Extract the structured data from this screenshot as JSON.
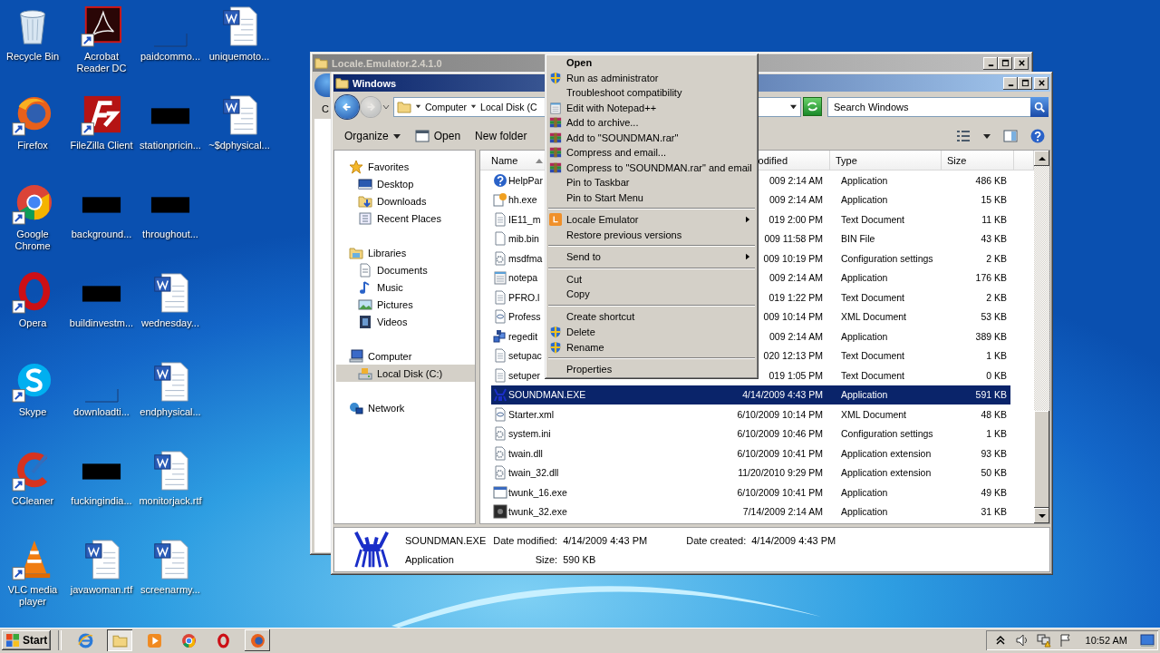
{
  "desktop": {
    "icons": [
      {
        "label": "Recycle Bin",
        "kind": "recycle",
        "shortcut": false
      },
      {
        "label": "Firefox",
        "kind": "firefox",
        "shortcut": true
      },
      {
        "label": "Google Chrome",
        "kind": "chrome",
        "shortcut": true
      },
      {
        "label": "Opera",
        "kind": "opera",
        "shortcut": true
      },
      {
        "label": "Skype",
        "kind": "skype",
        "shortcut": true
      },
      {
        "label": "CCleaner",
        "kind": "ccleaner",
        "shortcut": true
      },
      {
        "label": "VLC media player",
        "kind": "vlc",
        "shortcut": true
      },
      {
        "label": "Acrobat Reader DC",
        "kind": "pdf",
        "shortcut": true
      },
      {
        "label": "FileZilla Client",
        "kind": "filezilla",
        "shortcut": true
      },
      {
        "label": "background...",
        "kind": "redacted",
        "shortcut": false
      },
      {
        "label": "buildinvestm...",
        "kind": "redacted",
        "shortcut": false
      },
      {
        "label": "downloadti...",
        "kind": "blank",
        "shortcut": false
      },
      {
        "label": "fuckingindia...",
        "kind": "redacted",
        "shortcut": false
      },
      {
        "label": "javawoman.rtf",
        "kind": "word",
        "shortcut": false
      },
      {
        "label": "paidcommo...",
        "kind": "blank",
        "shortcut": false
      },
      {
        "label": "stationpricin...",
        "kind": "redacted",
        "shortcut": false
      },
      {
        "label": "throughout...",
        "kind": "redacted",
        "shortcut": false
      },
      {
        "label": "wednesday...",
        "kind": "word",
        "shortcut": false
      },
      {
        "label": "endphysical...",
        "kind": "word",
        "shortcut": false
      },
      {
        "label": "monitorjack.rtf",
        "kind": "word",
        "shortcut": false
      },
      {
        "label": "screenarmy...",
        "kind": "word",
        "shortcut": false
      },
      {
        "label": "uniquemoto...",
        "kind": "word",
        "shortcut": false
      },
      {
        "label": "~$dphysical...",
        "kind": "word",
        "shortcut": false
      }
    ]
  },
  "back_window": {
    "title": "Locale.Emulator.2.4.1.0",
    "toolbar_text": "C"
  },
  "explorer": {
    "title": "Windows",
    "nav_buttons": [
      {
        "kind": "back",
        "disabled": false
      },
      {
        "kind": "forward",
        "disabled": true
      }
    ],
    "breadcrumbs": [
      "Computer",
      "Local Disk (C"
    ],
    "search": {
      "placeholder": "Search Windows"
    },
    "toolbar": [
      {
        "label": "Organize",
        "kind": "menu"
      },
      {
        "label": "Open",
        "kind": "icon"
      },
      {
        "label": "New folder",
        "kind": "plain"
      }
    ],
    "nav": [
      {
        "label": "Favorites",
        "kind": "star",
        "selected": false,
        "children": [
          {
            "label": "Desktop",
            "kind": "desktop",
            "selected": false
          },
          {
            "label": "Downloads",
            "kind": "downloads",
            "selected": false
          },
          {
            "label": "Recent Places",
            "kind": "recent",
            "selected": false
          }
        ]
      },
      {
        "label": "Libraries",
        "kind": "libraries",
        "selected": false,
        "children": [
          {
            "label": "Documents",
            "kind": "documents",
            "selected": false
          },
          {
            "label": "Music",
            "kind": "music",
            "selected": false
          },
          {
            "label": "Pictures",
            "kind": "pictures",
            "selected": false
          },
          {
            "label": "Videos",
            "kind": "videos",
            "selected": false
          }
        ]
      },
      {
        "label": "Computer",
        "kind": "computer",
        "selected": false,
        "children": [
          {
            "label": "Local Disk (C:)",
            "kind": "disk",
            "selected": true
          }
        ]
      },
      {
        "label": "Network",
        "kind": "network",
        "selected": false
      }
    ],
    "columns": [
      {
        "label": "Name",
        "sorted": true
      },
      {
        "label": "odified",
        "sorted": false
      },
      {
        "label": "Type",
        "sorted": false
      },
      {
        "label": "Size",
        "sorted": false
      }
    ],
    "files": [
      {
        "name": "HelpPar",
        "kind": "help",
        "date": "009 2:14 AM",
        "type": "Application",
        "size": "486 KB",
        "selected": false
      },
      {
        "name": "hh.exe",
        "kind": "helpdoc",
        "date": "009 2:14 AM",
        "type": "Application",
        "size": "15 KB",
        "selected": false
      },
      {
        "name": "IE11_m",
        "kind": "text",
        "date": "019 2:00 PM",
        "type": "Text Document",
        "size": "11 KB",
        "selected": false
      },
      {
        "name": "mib.bin",
        "kind": "blank",
        "date": "009 11:58 PM",
        "type": "BIN File",
        "size": "43 KB",
        "selected": false
      },
      {
        "name": "msdfma",
        "kind": "config",
        "date": "009 10:19 PM",
        "type": "Configuration settings",
        "size": "2 KB",
        "selected": false
      },
      {
        "name": "notepa",
        "kind": "notepad",
        "date": "009 2:14 AM",
        "type": "Application",
        "size": "176 KB",
        "selected": false
      },
      {
        "name": "PFRO.l",
        "kind": "text",
        "date": "019 1:22 PM",
        "type": "Text Document",
        "size": "2 KB",
        "selected": false
      },
      {
        "name": "Profess",
        "kind": "xml",
        "date": "009 10:14 PM",
        "type": "XML Document",
        "size": "53 KB",
        "selected": false
      },
      {
        "name": "regedit",
        "kind": "regedit",
        "date": "009 2:14 AM",
        "type": "Application",
        "size": "389 KB",
        "selected": false
      },
      {
        "name": "setupac",
        "kind": "text",
        "date": "020 12:13 PM",
        "type": "Text Document",
        "size": "1 KB",
        "selected": false
      },
      {
        "name": "setuper",
        "kind": "text",
        "date": "019 1:05 PM",
        "type": "Text Document",
        "size": "0 KB",
        "selected": false
      },
      {
        "name": "SOUNDMAN.EXE",
        "kind": "crab",
        "date": "4/14/2009 4:43 PM",
        "type": "Application",
        "size": "591 KB",
        "selected": true
      },
      {
        "name": "Starter.xml",
        "kind": "xml",
        "date": "6/10/2009 10:14 PM",
        "type": "XML Document",
        "size": "48 KB",
        "selected": false
      },
      {
        "name": "system.ini",
        "kind": "config",
        "date": "6/10/2009 10:46 PM",
        "type": "Configuration settings",
        "size": "1 KB",
        "selected": false
      },
      {
        "name": "twain.dll",
        "kind": "dll",
        "date": "6/10/2009 10:41 PM",
        "type": "Application extension",
        "size": "93 KB",
        "selected": false
      },
      {
        "name": "twain_32.dll",
        "kind": "dll",
        "date": "11/20/2010 9:29 PM",
        "type": "Application extension",
        "size": "50 KB",
        "selected": false
      },
      {
        "name": "twunk_16.exe",
        "kind": "window",
        "date": "6/10/2009 10:41 PM",
        "type": "Application",
        "size": "49 KB",
        "selected": false
      },
      {
        "name": "twunk_32.exe",
        "kind": "dark",
        "date": "7/14/2009 2:14 AM",
        "type": "Application",
        "size": "31 KB",
        "selected": false
      }
    ],
    "details": {
      "name": "SOUNDMAN.EXE",
      "type": "Application",
      "fields": [
        {
          "label": "Date modified:",
          "value": "4/14/2009 4:43 PM"
        },
        {
          "label": "Date created:",
          "value": "4/14/2009 4:43 PM"
        },
        {
          "label": "Size:",
          "value": "590 KB"
        }
      ]
    }
  },
  "context_menu": {
    "items": [
      {
        "kind": "plain",
        "label": "Open",
        "default": true,
        "submenu": false
      },
      {
        "kind": "shield",
        "label": "Run as administrator",
        "default": false,
        "submenu": false
      },
      {
        "kind": "plain",
        "label": "Troubleshoot compatibility",
        "default": false,
        "submenu": false
      },
      {
        "kind": "notepad",
        "label": "Edit with Notepad++",
        "default": false,
        "submenu": false
      },
      {
        "kind": "rar",
        "label": "Add to archive...",
        "default": false,
        "submenu": false
      },
      {
        "kind": "rar",
        "label": "Add to \"SOUNDMAN.rar\"",
        "default": false,
        "submenu": false
      },
      {
        "kind": "rar",
        "label": "Compress and email...",
        "default": false,
        "submenu": false
      },
      {
        "kind": "rar",
        "label": "Compress to \"SOUNDMAN.rar\" and email",
        "default": false,
        "submenu": false
      },
      {
        "kind": "plain",
        "label": "Pin to Taskbar",
        "default": false,
        "submenu": false
      },
      {
        "kind": "plain",
        "label": "Pin to Start Menu",
        "default": false,
        "submenu": false
      },
      {
        "kind": "separator"
      },
      {
        "kind": "locale",
        "label": "Locale Emulator",
        "default": false,
        "submenu": true
      },
      {
        "kind": "plain",
        "label": "Restore previous versions",
        "default": false,
        "submenu": false
      },
      {
        "kind": "separator"
      },
      {
        "kind": "plain",
        "label": "Send to",
        "default": false,
        "submenu": true
      },
      {
        "kind": "separator"
      },
      {
        "kind": "plain",
        "label": "Cut",
        "default": false,
        "submenu": false
      },
      {
        "kind": "plain",
        "label": "Copy",
        "default": false,
        "submenu": false
      },
      {
        "kind": "separator"
      },
      {
        "kind": "plain",
        "label": "Create shortcut",
        "default": false,
        "submenu": false
      },
      {
        "kind": "shield",
        "label": "Delete",
        "default": false,
        "submenu": false
      },
      {
        "kind": "shield",
        "label": "Rename",
        "default": false,
        "submenu": false
      },
      {
        "kind": "separator"
      },
      {
        "kind": "plain",
        "label": "Properties",
        "default": false,
        "submenu": false
      }
    ]
  },
  "taskbar": {
    "start": "Start",
    "apps": [
      {
        "kind": "ie",
        "running": false,
        "selected": false
      },
      {
        "kind": "folder",
        "running": true,
        "selected": true
      },
      {
        "kind": "player",
        "running": false,
        "selected": false
      },
      {
        "kind": "chrome",
        "running": false,
        "selected": false
      },
      {
        "kind": "opera",
        "running": false,
        "selected": false
      },
      {
        "kind": "firefox",
        "running": true,
        "selected": false
      }
    ],
    "clock": "10:52 AM"
  }
}
